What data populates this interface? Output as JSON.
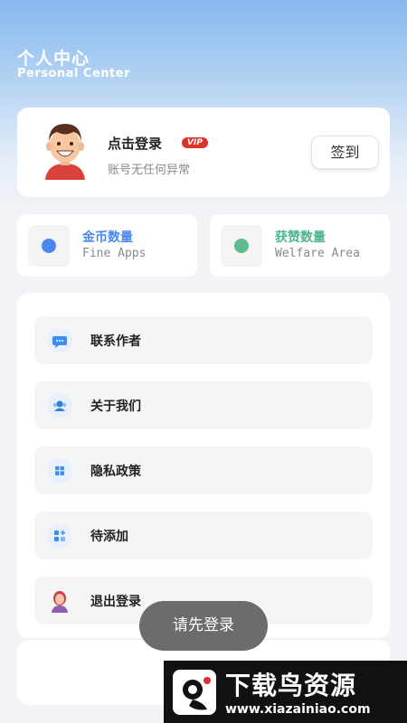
{
  "header": {
    "title": "个人中心",
    "subtitle": "Personal Center"
  },
  "profile": {
    "title": "点击登录",
    "vip_badge": "VIP",
    "status": "账号无任何异常",
    "signin_label": "签到"
  },
  "stats": [
    {
      "title": "金币数量",
      "subtitle": "Fine Apps",
      "color": "#4a88f0",
      "dot_color": "#4a88f0"
    },
    {
      "title": "获赞数量",
      "subtitle": "Welfare Area",
      "color": "#4db58a",
      "dot_color": "#5dbb8f"
    }
  ],
  "menu": [
    {
      "label": "联系作者",
      "icon": "chat-icon"
    },
    {
      "label": "关于我们",
      "icon": "user-group-icon"
    },
    {
      "label": "隐私政策",
      "icon": "shield-icon"
    },
    {
      "label": "待添加",
      "icon": "apps-add-icon"
    },
    {
      "label": "退出登录",
      "icon": "woman-avatar-icon"
    }
  ],
  "toast": {
    "text": "请先登录"
  },
  "watermark": {
    "title": "下载鸟资源",
    "url": "www.xiazainiao.com"
  }
}
